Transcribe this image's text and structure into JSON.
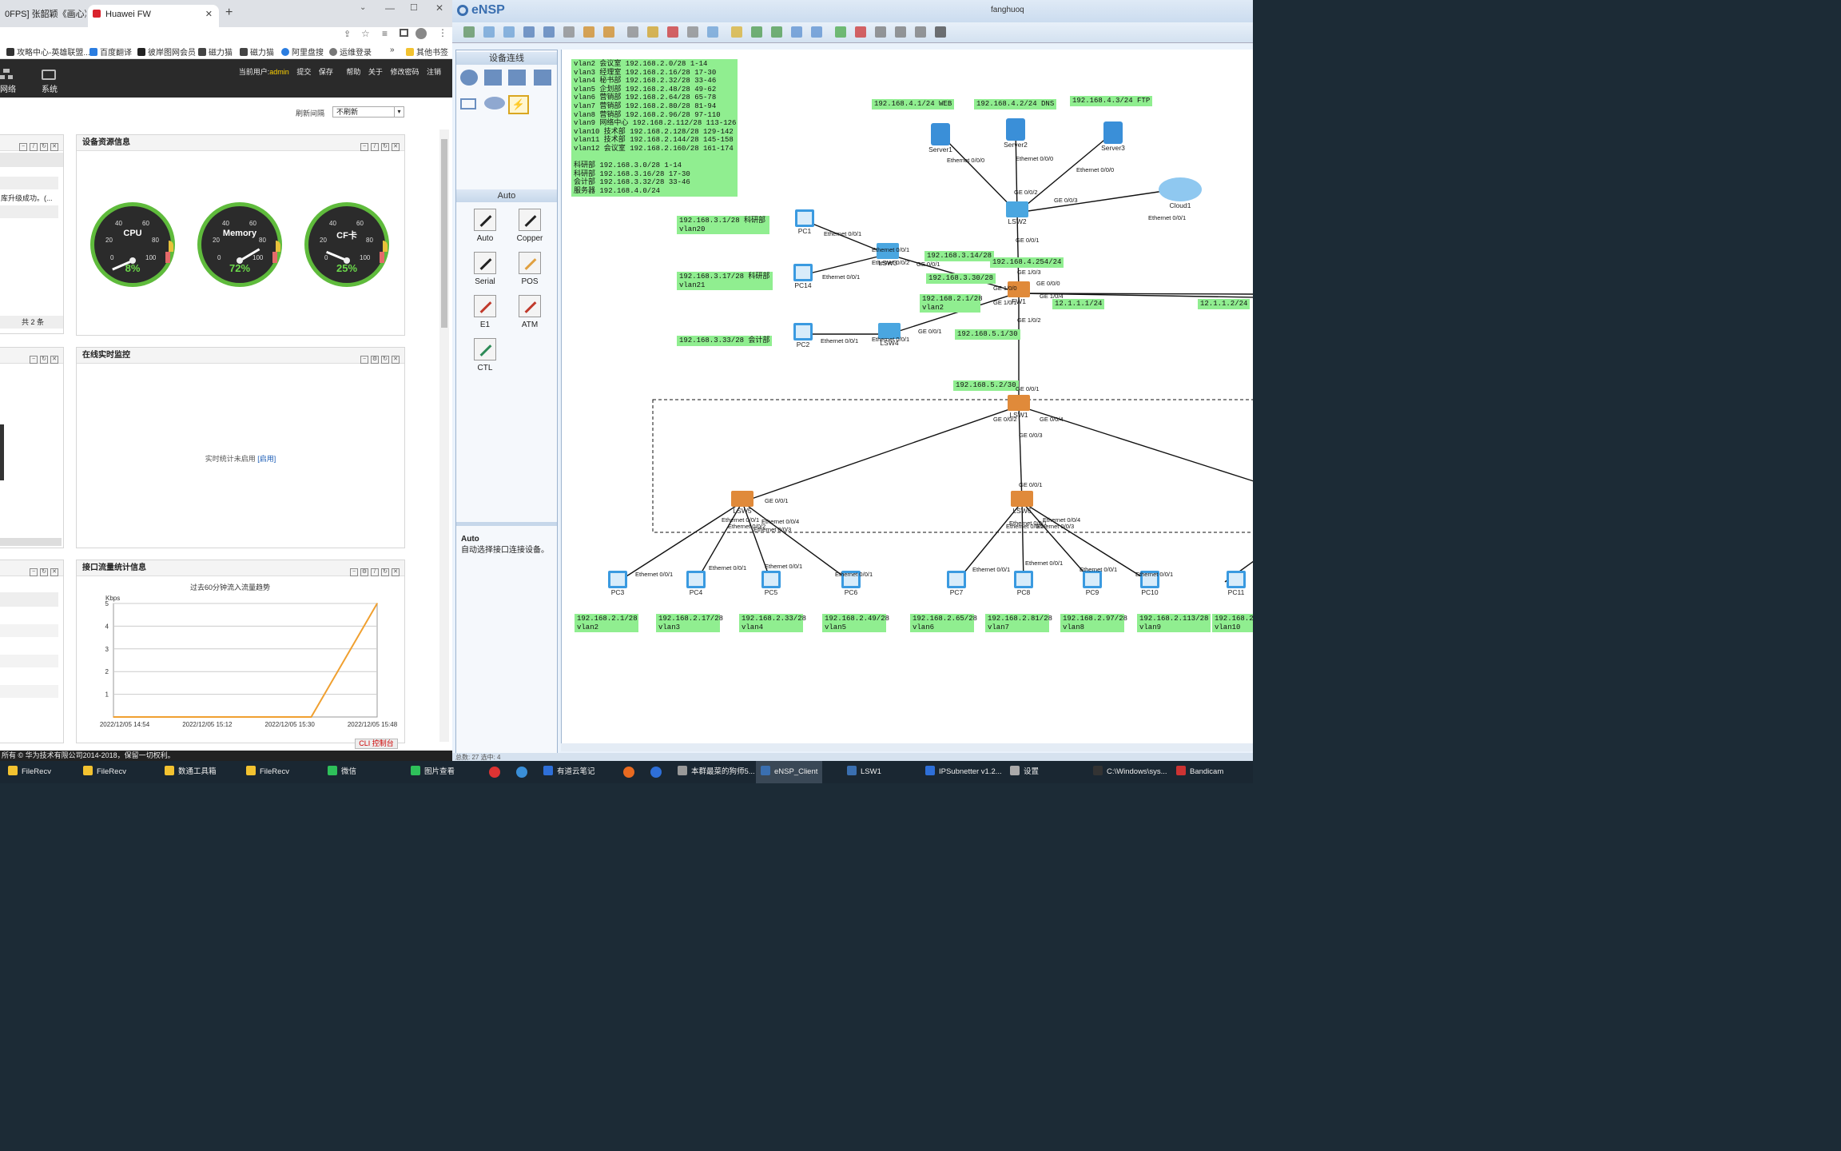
{
  "browser": {
    "tabs": [
      {
        "label": "0FPS] 张韶颖《画心》影"
      },
      {
        "label": "Huawei FW"
      }
    ],
    "new_tab": "+",
    "bookmarks": [
      {
        "label": "攻略中心-英雄联盟..."
      },
      {
        "label": "百度翻译"
      },
      {
        "label": "彼岸图网会员"
      },
      {
        "label": "磁力猫"
      },
      {
        "label": "磁力猫"
      },
      {
        "label": "阿里盘搜"
      },
      {
        "label": "运维登录"
      },
      {
        "label": "其他书签"
      }
    ],
    "bookmarks_more": "»"
  },
  "fw": {
    "nav": [
      {
        "label": "网络"
      },
      {
        "label": "系统"
      }
    ],
    "current_user_label": "当前用户:",
    "current_user": "admin",
    "links": [
      "提交",
      "保存",
      "帮助",
      "关于",
      "修改密码",
      "注销"
    ],
    "refresh_label": "刷新间隔",
    "refresh_value": "不刷新",
    "left_panel": {
      "row_text": "库升级成功。(...",
      "total": "共 2 条"
    },
    "resource_panel": {
      "title": "设备资源信息",
      "gauges": [
        {
          "name": "CPU",
          "value": "8%",
          "level": 0.08
        },
        {
          "name": "Memory",
          "value": "72%",
          "level": 0.72
        },
        {
          "name": "CF卡",
          "value": "25%",
          "level": 0.25
        }
      ],
      "ticks": [
        "0",
        "20",
        "40",
        "60",
        "80",
        "100"
      ]
    },
    "monitor_panel": {
      "title": "在线实时监控",
      "message": "实时统计未启用",
      "enable_link": "[启用]"
    },
    "traffic_panel": {
      "title": "接口流量统计信息",
      "chart_title": "过去60分钟流入流量趋势",
      "unit": "Kbps"
    },
    "cli_button": "CLI 控制台",
    "footer": "所有 © 华为技术有限公司2014-2018，保留一切权利。"
  },
  "chart_data": {
    "type": "line",
    "title": "过去60分钟流入流量趋势",
    "ylabel": "Kbps",
    "ylim": [
      0,
      5
    ],
    "yticks": [
      "1",
      "2",
      "3",
      "4",
      "5"
    ],
    "x_ticks": [
      "2022/12/05 14:54",
      "2022/12/05 15:12",
      "2022/12/05 15:30",
      "2022/12/05 15:48"
    ],
    "series": [
      {
        "values": [
          0,
          0,
          0,
          0,
          5
        ]
      }
    ]
  },
  "ensp": {
    "app_name": "eNSP",
    "title": "fanghuoq",
    "device_section": "设备连线",
    "auto_section": "Auto",
    "cables": [
      "Auto",
      "Copper",
      "Serial",
      "POS",
      "E1",
      "ATM",
      "CTL"
    ],
    "info_title": "Auto",
    "info_text": "自动选择接口连接设备。",
    "status": "总数: 27 选中: 4",
    "notes": {
      "vlan_list": "vlan2 会议室 192.168.2.0/28 1-14\nvlan3 经理室 192.168.2.16/28 17-30\nvlan4 秘书部 192.168.2.32/28 33-46\nvlan5 企划部 192.168.2.48/28 49-62\nvlan6 营销部 192.168.2.64/28 65-78\nvlan7 营销部 192.168.2.80/28 81-94\nvlan8 营销部 192.168.2.96/28 97-110\nvlan9 网络中心 192.168.2.112/28 113-126\nvlan10 技术部 192.168.2.128/28 129-142\nvlan11 技术部 192.168.2.144/28 145-158\nvlan12 会议室 192.168.2.160/28 161-174\n\n科研部 192.168.3.0/28 1-14\n科研部 192.168.3.16/28 17-30\n会计部 192.168.3.32/28 33-46\n服务器 192.168.4.0/24",
      "web": "192.168.4.1/24 WEB",
      "dns": "192.168.4.2/24 DNS",
      "ftp": "192.168.4.3/24 FTP",
      "pc1": "192.168.3.1/28 科研部\nvlan20",
      "pc14": "192.168.3.17/28 科研部\nvlan21",
      "pc2": "192.168.3.33/28 会计部",
      "lsw3_up": "192.168.3.14/28",
      "lsw3_gw": "192.168.3.30/28",
      "vlan2gw": "192.168.2.1/28\nvlan2",
      "srv_gw": "192.168.4.254/24",
      "isp1": "12.1.1.1/24",
      "isp2": "12.1.1.2/24",
      "lsw4_gw": "192.168.5.1/30",
      "lsw1_ip": "192.168.5.2/30",
      "pc3": "192.168.2.1/28\nvlan2",
      "pc4": "192.168.2.17/28\nvlan3",
      "pc5": "192.168.2.33/28\nvlan4",
      "pc6": "192.168.2.49/28\nvlan5",
      "pc7": "192.168.2.65/28\nvlan6",
      "pc8": "192.168.2.81/28\nvlan7",
      "pc9": "192.168.2.97/28\nvlan8",
      "pc10": "192.168.2.113/28\nvlan9",
      "pc11": "192.168.2.\nvlan10"
    },
    "devices": {
      "server1": "Server1",
      "server2": "Server2",
      "server3": "Server3",
      "cloud1": "Cloud1",
      "lsw2": "LSW2",
      "lsw3": "LSW3",
      "lsw4": "LSW4",
      "fw1": "FW1",
      "lsw1": "LSW1",
      "lsw5": "LSW5",
      "lsw6": "LSW6",
      "pc1": "PC1",
      "pc14": "PC14",
      "pc2": "PC2",
      "pc3": "PC3",
      "pc4": "PC4",
      "pc5": "PC5",
      "pc6": "PC6",
      "pc7": "PC7",
      "pc8": "PC8",
      "pc9": "PC9",
      "pc10": "PC10",
      "pc11": "PC11"
    },
    "ports": {
      "eth000": "Ethernet 0/0/0",
      "eth001": "Ethernet 0/0/1",
      "eth002": "Ethernet 0/0/2",
      "eth003": "Ethernet 0/0/3",
      "eth004": "Ethernet 0/0/4",
      "ge000": "GE 0/0/0",
      "ge001": "GE 0/0/1",
      "ge002": "GE 0/0/2",
      "ge003": "GE 0/0/3",
      "ge004": "GE 0/0/4",
      "ge100": "GE 1/0/0",
      "ge101": "GE 1/0/1",
      "ge102": "GE 1/0/2",
      "ge103": "GE 1/0/3",
      "ge104": "GE 1/0/4"
    }
  },
  "taskbar": [
    {
      "label": "FileRecv"
    },
    {
      "label": "FileRecv"
    },
    {
      "label": "数通工具箱"
    },
    {
      "label": "FileRecv"
    },
    {
      "label": "微信"
    },
    {
      "label": "图片查看"
    },
    {
      "label": "有道云笔记"
    },
    {
      "label": "本群最菜的狗师5..."
    },
    {
      "label": "eNSP_Client"
    },
    {
      "label": "LSW1"
    },
    {
      "label": "IPSubnetter v1.2..."
    },
    {
      "label": "设置"
    },
    {
      "label": "C:\\Windows\\sys..."
    },
    {
      "label": "Bandicam"
    }
  ],
  "colors": {
    "note_bg": "#90ee90",
    "gauge_green": "#5fbb3c",
    "fw_header": "#2a2a2a",
    "taskbar": "#1a2732"
  }
}
